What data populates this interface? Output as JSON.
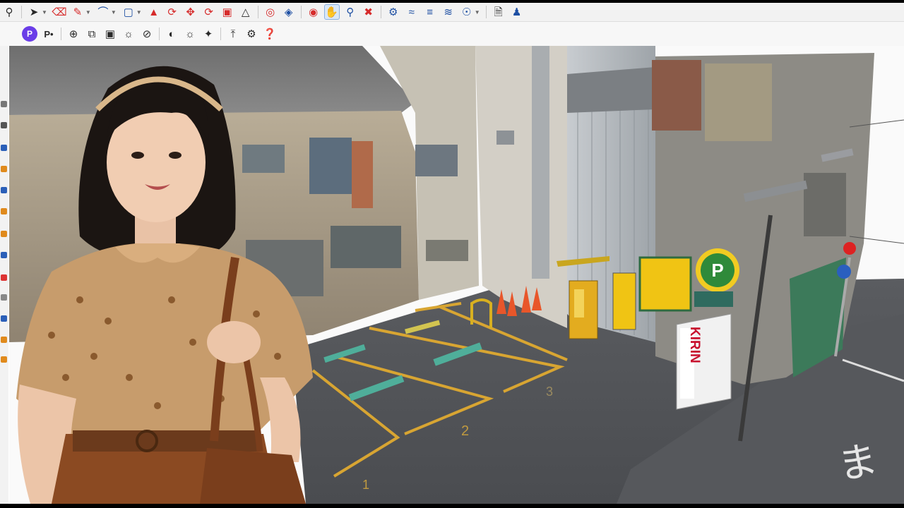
{
  "toolbar_top": {
    "icons": [
      "zoom-icon",
      "select-icon",
      "eraser-icon",
      "line-icon",
      "arc-icon",
      "rectangle-icon",
      "push-pull-icon",
      "follow-me-icon",
      "move-icon",
      "rotate-icon",
      "scale-icon",
      "offset-icon",
      "tape-measure-icon",
      "section-plane-icon",
      "orbit-icon",
      "pan-icon",
      "zoom-tool-icon",
      "zoom-extents-icon",
      "geo-location-icon",
      "terrain-icon",
      "layers-icon",
      "sandbox-icon",
      "components-icon",
      "document-icon",
      "user-icon"
    ]
  },
  "toolbar_plugins": {
    "icons": [
      "plugin-p-icon",
      "plugin-p2-icon",
      "add-component-icon",
      "copy-icon",
      "camera-icon",
      "gear-brush-icon",
      "no-entry-icon",
      "striped-ball-icon",
      "light-bulb-icon",
      "origami-icon",
      "export-icon",
      "settings-gear-icon",
      "help-icon"
    ]
  },
  "scene": {
    "signs": {
      "parking": "P",
      "vending_brand": "KIRIN",
      "lot_number_2": "2",
      "lot_number_3": "3",
      "lot_number_1": "1",
      "road_text": "ま"
    }
  },
  "colors": {
    "accent": "#1d4fa3",
    "parking_sign": "#2f8a3a",
    "kirin_red": "#c8102e",
    "lot_lines": "#d8a532"
  }
}
